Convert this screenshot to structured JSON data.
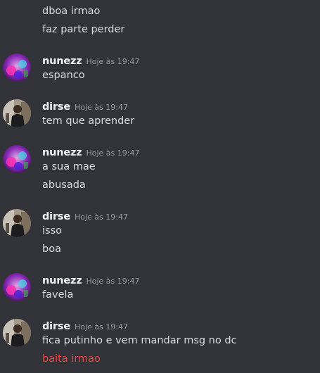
{
  "colors": {
    "background": "#313338",
    "message_text": "#dbdee1",
    "username": "#f2f3f5",
    "timestamp": "#949ba4",
    "error_text": "#f23f43"
  },
  "messages": [
    {
      "type": "continuation",
      "text": "dboa irmao"
    },
    {
      "type": "continuation",
      "text": "faz parte perder"
    },
    {
      "type": "group",
      "author": "nunezz",
      "avatar": "nunezz-avatar",
      "timestamp": "Hoje às 19:47",
      "lines": [
        "espanco"
      ]
    },
    {
      "type": "group",
      "author": "dirse",
      "avatar": "dirse-avatar",
      "timestamp": "Hoje às 19:47",
      "lines": [
        "tem que aprender"
      ]
    },
    {
      "type": "group",
      "author": "nunezz",
      "avatar": "nunezz-avatar",
      "timestamp": "Hoje às 19:47",
      "lines": [
        "a sua mae",
        "abusada"
      ]
    },
    {
      "type": "group",
      "author": "dirse",
      "avatar": "dirse-avatar",
      "timestamp": "Hoje às 19:47",
      "lines": [
        "isso",
        "boa"
      ]
    },
    {
      "type": "group",
      "author": "nunezz",
      "avatar": "nunezz-avatar",
      "timestamp": "Hoje às 19:47",
      "lines": [
        "favela"
      ]
    },
    {
      "type": "group",
      "author": "dirse",
      "avatar": "dirse-avatar",
      "timestamp": "Hoje às 19:47",
      "lines": [
        "fica putinho e vem mandar msg no dc"
      ],
      "failed_lines": [
        "baita irmao"
      ]
    }
  ]
}
